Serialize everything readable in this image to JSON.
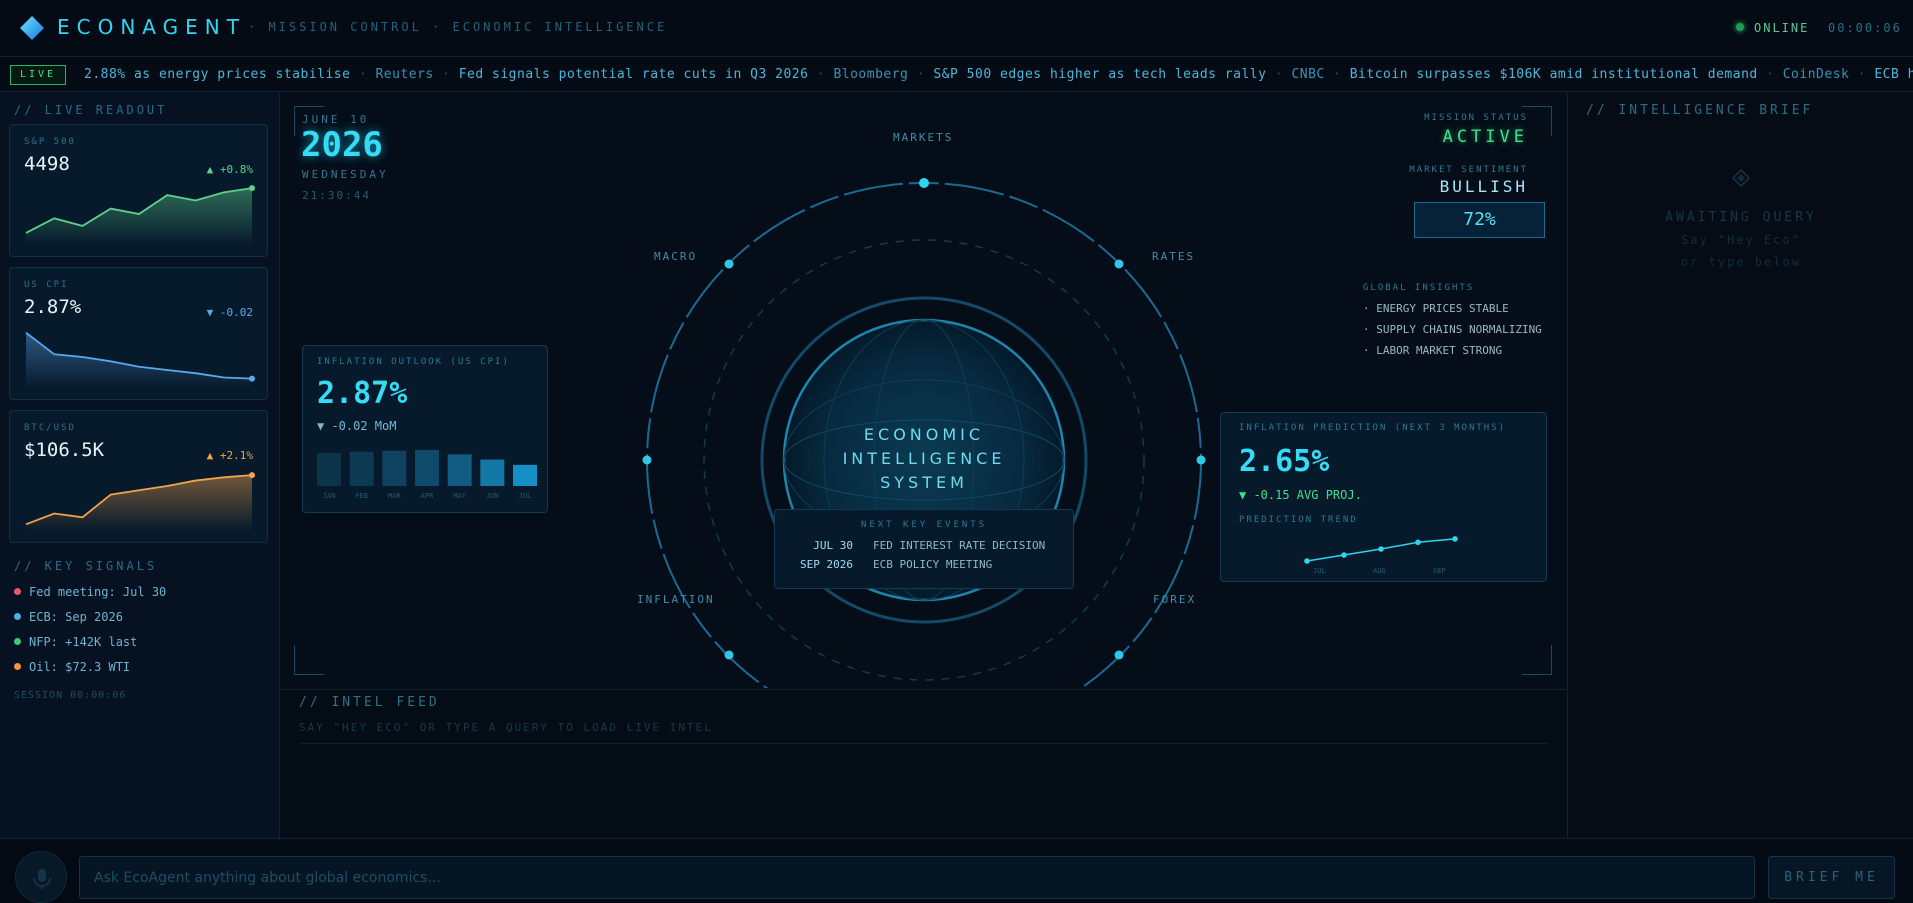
{
  "header": {
    "brand": "ECONAGENT",
    "breadcrumb": "· MISSION CONTROL · ECONOMIC INTELLIGENCE",
    "status": "ONLINE",
    "clock": "00:00:06"
  },
  "ticker": {
    "live_label": "LIVE",
    "items": [
      {
        "headline": "2.88% as energy prices stabilise",
        "source": "Reuters"
      },
      {
        "headline": "Fed signals potential rate cuts in Q3 2026",
        "source": "Bloomberg"
      },
      {
        "headline": "S&P 500 edges higher as tech leads rally",
        "source": "CNBC"
      },
      {
        "headline": "Bitcoin surpasses $106K amid institutional demand",
        "source": "CoinDesk"
      },
      {
        "headline": "ECB holds rate",
        "source": ""
      }
    ]
  },
  "left": {
    "readout_title": "// LIVE READOUT",
    "cards": [
      {
        "label": "S&P 500",
        "value": "4498",
        "change": "▲ +0.8%",
        "color": "#5ed18a",
        "spark": [
          0.15,
          0.42,
          0.28,
          0.6,
          0.5,
          0.85,
          0.75,
          0.9,
          0.98
        ]
      },
      {
        "label": "US CPI",
        "value": "2.87%",
        "change": "▼ -0.02",
        "color": "#5aa8ee",
        "spark": [
          0.95,
          0.55,
          0.5,
          0.42,
          0.32,
          0.26,
          0.2,
          0.12,
          0.1
        ]
      },
      {
        "label": "BTC/USD",
        "value": "$106.5K",
        "change": "▲ +2.1%",
        "color": "#f2a24a",
        "spark": [
          0.05,
          0.25,
          0.18,
          0.6,
          0.68,
          0.76,
          0.86,
          0.92,
          0.96
        ]
      }
    ],
    "signals_title": "// KEY SIGNALS",
    "signals": [
      {
        "text": "Fed meeting: Jul 30",
        "color": "#e85a6a"
      },
      {
        "text": "ECB: Sep 2026",
        "color": "#4fb0e8"
      },
      {
        "text": "NFP: +142K last",
        "color": "#3ec87a"
      },
      {
        "text": "Oil: $72.3 WTI",
        "color": "#f2963a"
      }
    ],
    "session": "SESSION 00:00:06"
  },
  "date_block": {
    "month_day": "JUNE 10",
    "year": "2026",
    "weekday": "WEDNESDAY",
    "time": "21:30:44"
  },
  "mission": {
    "status_label": "MISSION STATUS",
    "status": "ACTIVE",
    "sentiment_label": "MARKET SENTIMENT",
    "sentiment": "BULLISH",
    "sentiment_pct": "72%"
  },
  "orbit": {
    "labels": {
      "top": "MARKETS",
      "upper_left": "MACRO",
      "upper_right": "RATES",
      "lower_left": "INFLATION",
      "lower_right": "FOREX"
    },
    "core": [
      "ECONOMIC",
      "INTELLIGENCE",
      "SYSTEM"
    ]
  },
  "events": {
    "title": "NEXT KEY EVENTS",
    "items": [
      {
        "date": "JUL 30",
        "name": "FED INTEREST RATE DECISION"
      },
      {
        "date": "SEP 2026",
        "name": "ECB POLICY MEETING"
      }
    ]
  },
  "insights": {
    "title": "GLOBAL INSIGHTS",
    "items": [
      "· ENERGY PRICES STABLE",
      "· SUPPLY CHAINS NORMALIZING",
      "· LABOR MARKET STRONG"
    ]
  },
  "outlook": {
    "title": "INFLATION OUTLOOK (US CPI)",
    "value": "2.87%",
    "change": "▼ -0.02 MoM"
  },
  "prediction": {
    "title": "INFLATION PREDICTION (NEXT 3 MONTHS)",
    "value": "2.65%",
    "change": "▼ -0.15 AVG PROJ.",
    "trend_label": "PREDICTION TREND"
  },
  "chart_data": [
    {
      "type": "bar",
      "categories": [
        "JAN",
        "FEB",
        "MAR",
        "APR",
        "MAY",
        "JUN",
        "JUL"
      ],
      "values": [
        0.75,
        0.78,
        0.8,
        0.82,
        0.72,
        0.6,
        0.48
      ],
      "title": "",
      "xlabel": "",
      "ylabel": ""
    },
    {
      "type": "line",
      "categories": [
        "JUL",
        "AUG",
        "SEP"
      ],
      "x": [
        0,
        1,
        2,
        3,
        4
      ],
      "values": [
        0.0,
        0.25,
        0.5,
        0.78,
        0.92
      ],
      "title": "",
      "xlabel": "",
      "ylabel": ""
    }
  ],
  "feed": {
    "title": "// INTEL FEED",
    "empty": "SAY \"HEY ECO\" OR TYPE A QUERY TO LOAD LIVE INTEL"
  },
  "brief": {
    "title": "// INTELLIGENCE BRIEF",
    "awaiting": "AWAITING QUERY",
    "hint1": "Say \"Hey Eco\"",
    "hint2": "or type below"
  },
  "bottom": {
    "placeholder": "Ask EcoAgent anything about global economics...",
    "button": "BRIEF ME"
  },
  "colors": {
    "accent": "#2fd4ef",
    "green": "#3ee08a",
    "bg": "#050d18"
  }
}
